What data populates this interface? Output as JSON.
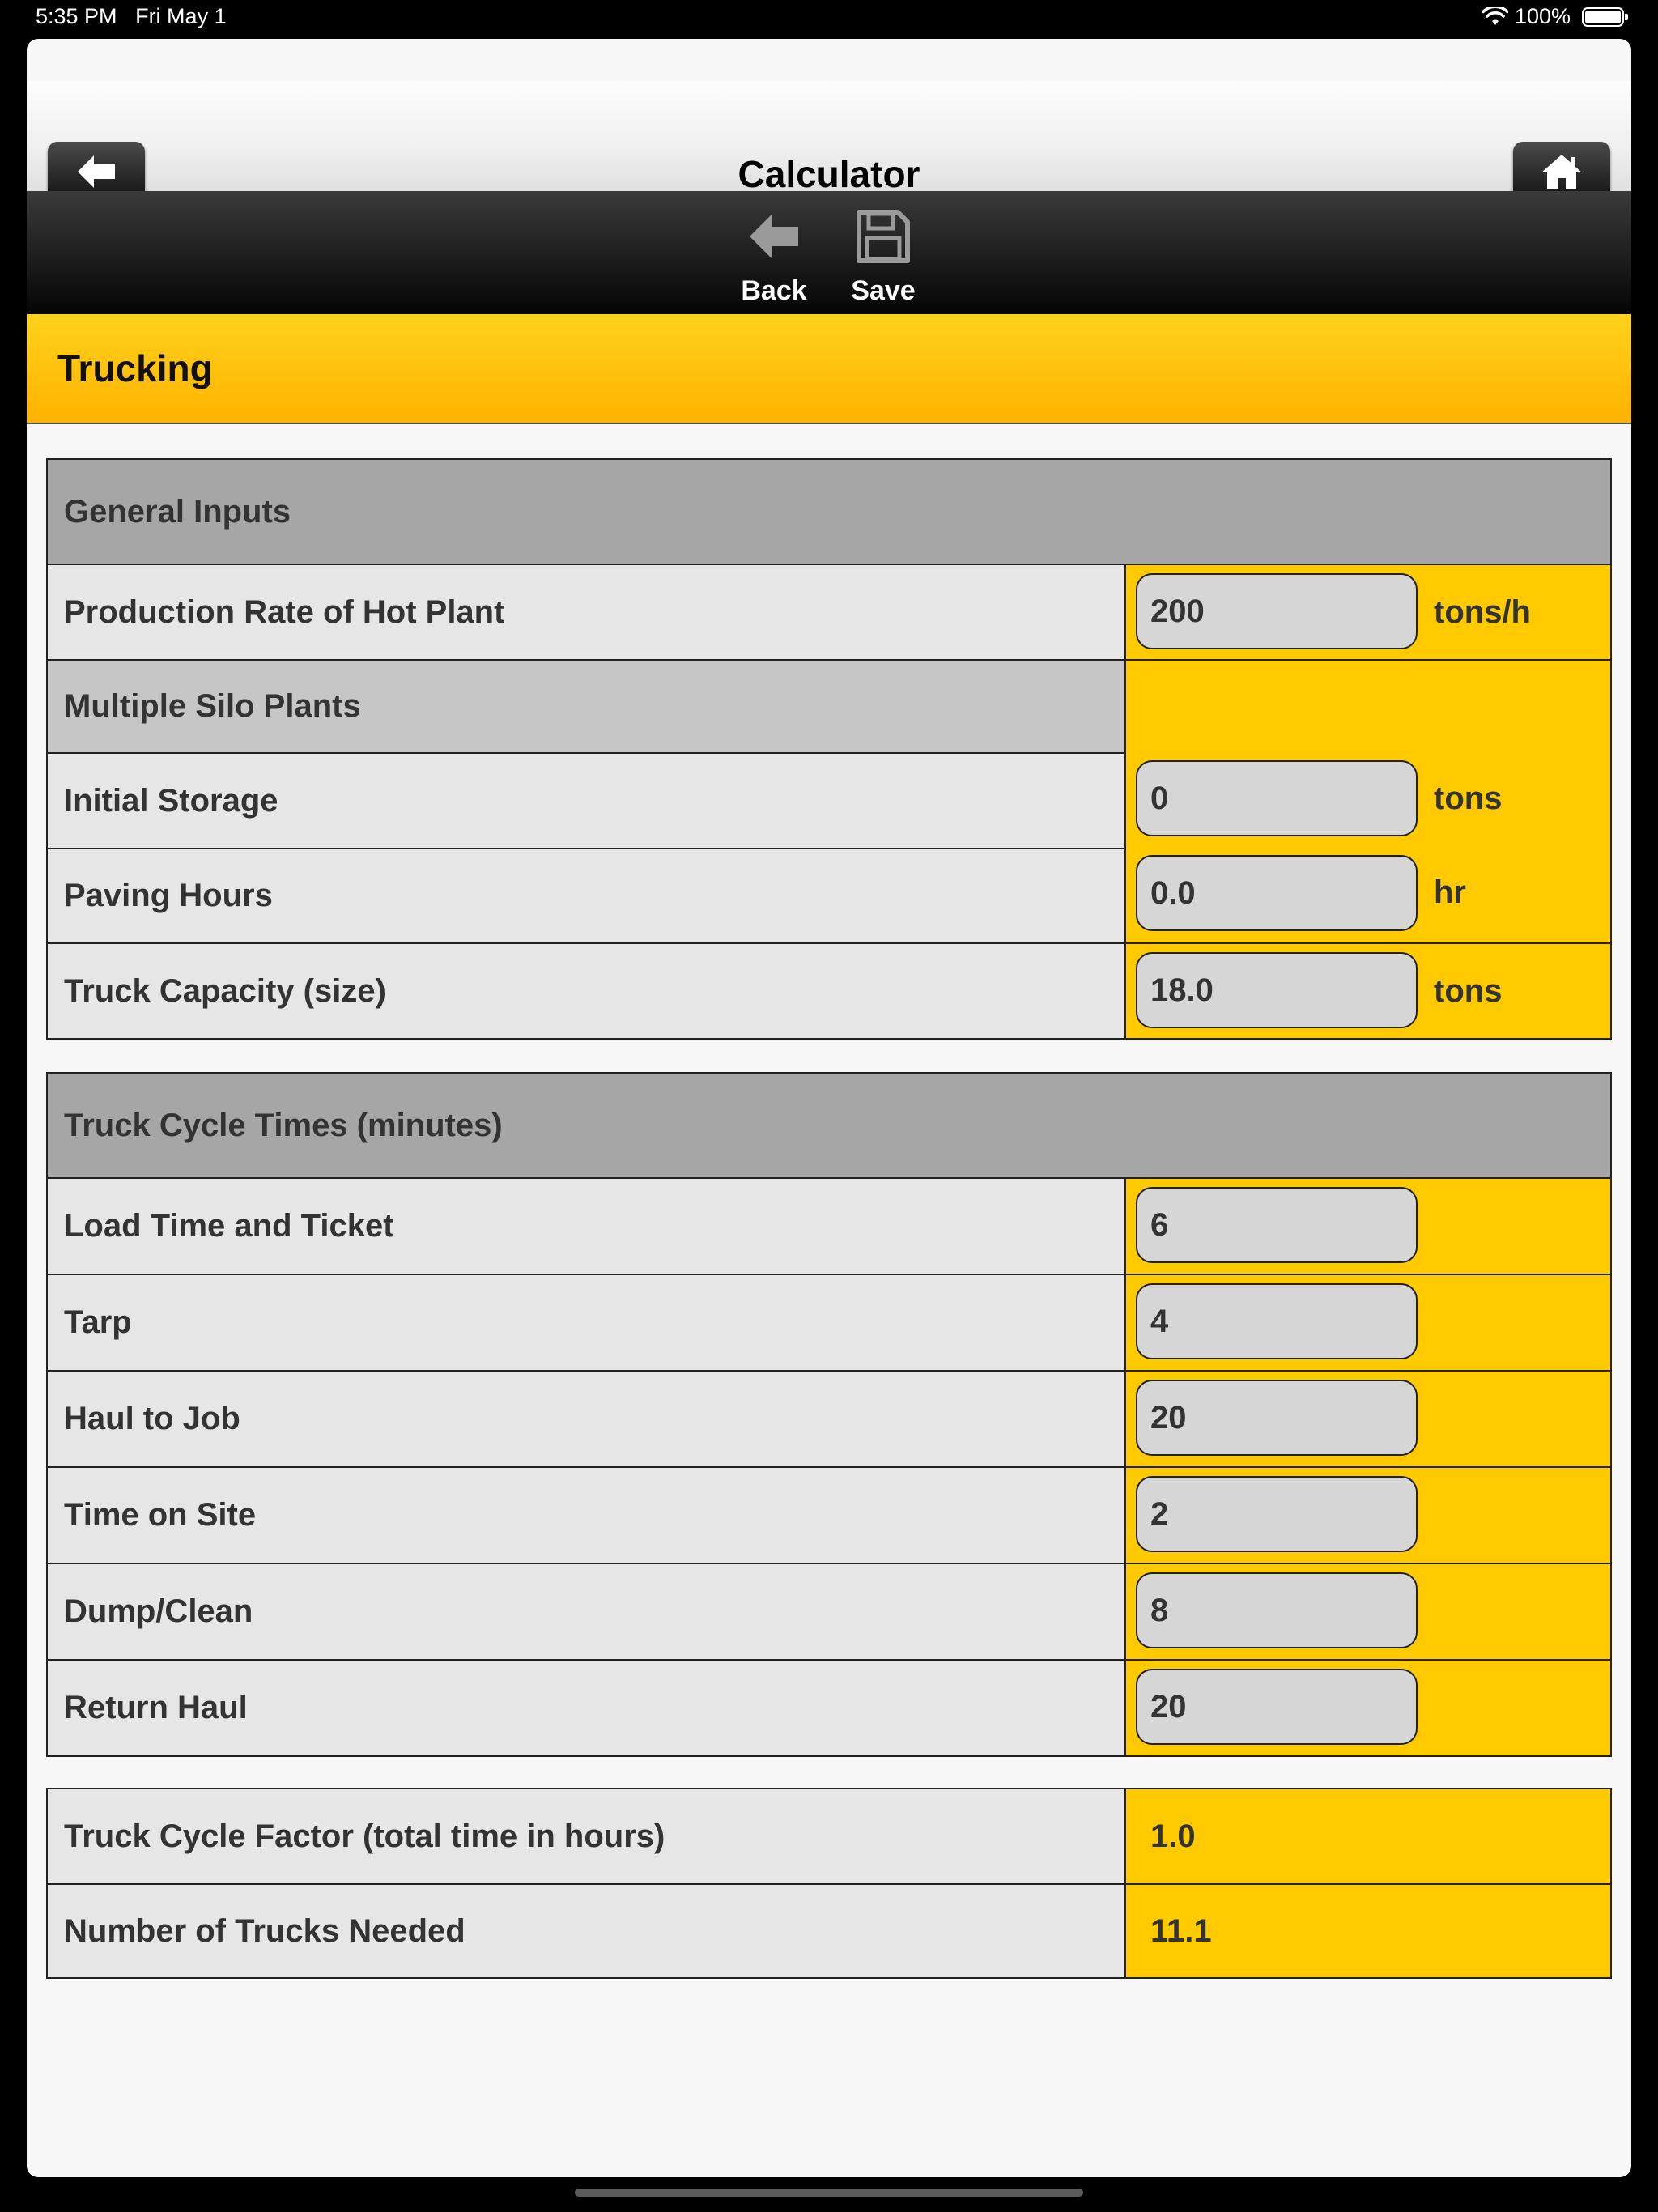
{
  "status_bar": {
    "time": "5:35 PM",
    "date": "Fri May 1",
    "battery": "100%"
  },
  "header": {
    "title": "Calculator"
  },
  "toolbar": {
    "back_label": "Back",
    "save_label": "Save"
  },
  "section": {
    "title": "Trucking"
  },
  "general": {
    "heading": "General Inputs",
    "production_label": "Production Rate of Hot Plant",
    "production_value": "200",
    "production_unit": "tons/h",
    "multiple_silo_label": "Multiple Silo Plants",
    "initial_storage_label": "Initial Storage",
    "initial_storage_value": "0",
    "initial_storage_unit": "tons",
    "paving_hours_label": "Paving Hours",
    "paving_hours_value": "0.0",
    "paving_hours_unit": "hr",
    "truck_capacity_label": "Truck Capacity (size)",
    "truck_capacity_value": "18.0",
    "truck_capacity_unit": "tons"
  },
  "cycle": {
    "heading": "Truck Cycle Times (minutes)",
    "rows": [
      {
        "label": "Load Time and Ticket",
        "value": "6"
      },
      {
        "label": "Tarp",
        "value": "4"
      },
      {
        "label": "Haul to Job",
        "value": "20"
      },
      {
        "label": "Time on Site",
        "value": "2"
      },
      {
        "label": "Dump/Clean",
        "value": "8"
      },
      {
        "label": "Return Haul",
        "value": "20"
      }
    ]
  },
  "results": {
    "rows": [
      {
        "label": "Truck Cycle Factor (total time in hours)",
        "value": "1.0"
      },
      {
        "label": "Number of Trucks Needed",
        "value": "11.1"
      }
    ]
  },
  "colors": {
    "accent": "#ffcb00",
    "banner": "#ffc20e",
    "label_bg": "#e6e6e6",
    "heading_bg": "#a6a6a6"
  }
}
